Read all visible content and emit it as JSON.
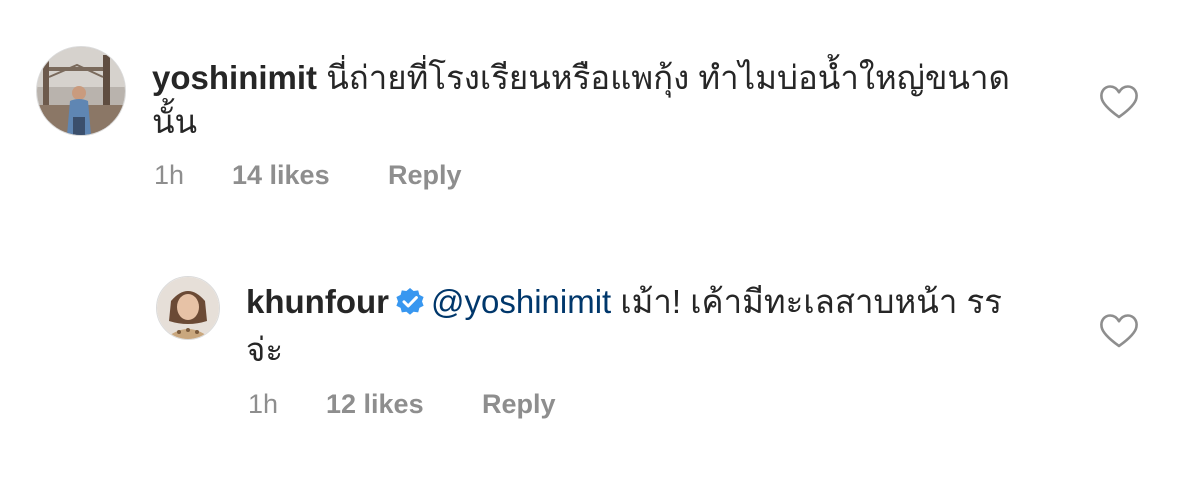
{
  "comments": [
    {
      "username": "yoshinimit",
      "text": "นี่ถ่ายที่โรงเรียนหรือแพกุ้ง ทำไมบ่อน้ำใหญ่ขนาด",
      "text_line2": "นั้น",
      "time": "1h",
      "likes": "14 likes",
      "reply": "Reply",
      "avatar_icon": "profile-photo-man-on-bridge",
      "like_icon": "heart-outline-icon"
    },
    {
      "username": "khunfour",
      "verified_icon": "verified-badge-icon",
      "mention": "@yoshinimit",
      "text": " เม้า! เค้ามีทะเลสาบหน้า รร",
      "text_line2": "จ่ะ",
      "time": "1h",
      "likes": "12 likes",
      "reply": "Reply",
      "avatar_icon": "profile-photo-woman",
      "like_icon": "heart-outline-icon"
    }
  ],
  "colors": {
    "text": "#262626",
    "muted": "#8e8e8e",
    "mention": "#00376b",
    "verified": "#3897f0"
  }
}
